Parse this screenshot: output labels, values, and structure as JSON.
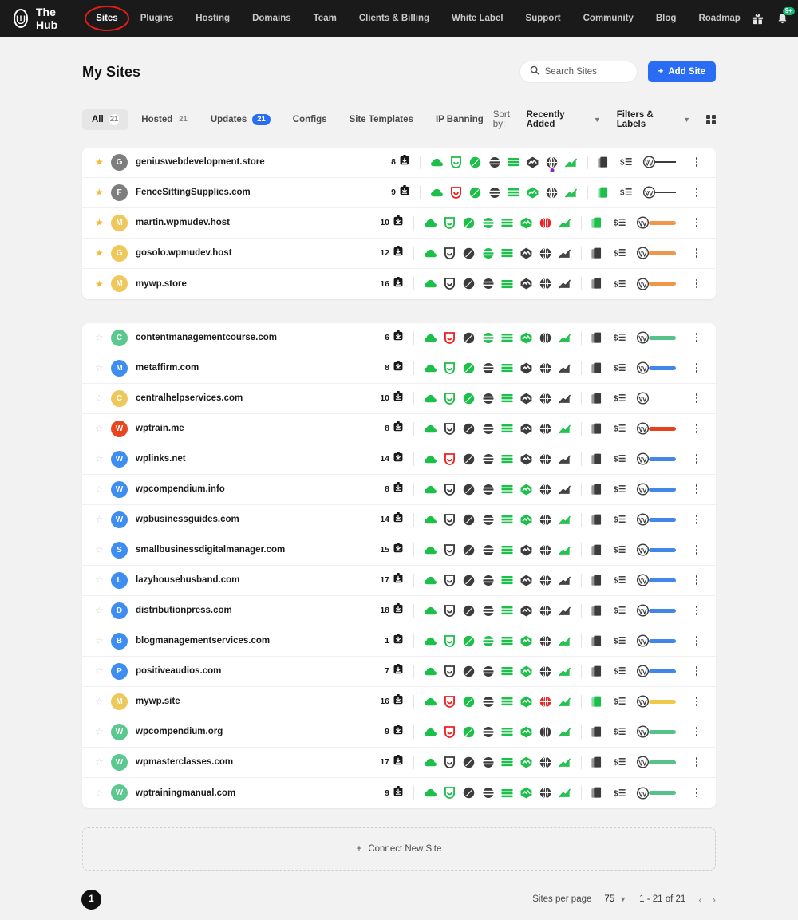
{
  "topnav": {
    "brand": "The Hub",
    "logo_icon": "hub-logo-icon",
    "items": [
      {
        "label": "Sites",
        "active": true,
        "circled": true
      },
      {
        "label": "Plugins",
        "active": false,
        "circled": false
      },
      {
        "label": "Hosting",
        "active": false,
        "circled": false
      },
      {
        "label": "Domains",
        "active": false,
        "circled": false
      },
      {
        "label": "Team",
        "active": false,
        "circled": false
      },
      {
        "label": "Clients & Billing",
        "active": false,
        "circled": false
      },
      {
        "label": "White Label",
        "active": false,
        "circled": false
      },
      {
        "label": "Support",
        "active": false,
        "circled": false
      },
      {
        "label": "Community",
        "active": false,
        "circled": false
      },
      {
        "label": "Blog",
        "active": false,
        "circled": false
      },
      {
        "label": "Roadmap",
        "active": false,
        "circled": false
      }
    ],
    "gift_icon": "gift-icon",
    "bell_icon": "bell-icon",
    "notification_badge": "9+",
    "gear_icon": "gear-icon",
    "avatar": "user-avatar"
  },
  "header": {
    "title": "My Sites",
    "search_placeholder": "Search Sites",
    "search_value": "",
    "search_icon": "search-icon",
    "add_site_label": "Add Site",
    "add_site_plus": "+",
    "accent_blue": "#2a6df4"
  },
  "tabbar": {
    "tabs": [
      {
        "label": "All",
        "count": "21",
        "active": true,
        "count_style": "plain"
      },
      {
        "label": "Hosted",
        "count": "21",
        "active": false,
        "count_style": "plain"
      },
      {
        "label": "Updates",
        "count": "21",
        "active": false,
        "count_style": "blue"
      },
      {
        "label": "Configs",
        "count": "",
        "active": false,
        "count_style": "none"
      },
      {
        "label": "Site Templates",
        "count": "",
        "active": false,
        "count_style": "none"
      },
      {
        "label": "IP Banning",
        "count": "",
        "active": false,
        "count_style": "none"
      }
    ],
    "sort_label": "Sort by:",
    "sort_value": "Recently Added",
    "filters_label": "Filters & Labels",
    "grid_toggle_icon": "grid-view-icon"
  },
  "service_icons": [
    "cloud-icon",
    "shield-icon",
    "smush-icon",
    "hummingbird-icon",
    "defender-icon",
    "branda-icon",
    "smartcrawl-icon",
    "analytics-icon"
  ],
  "tail_icons": [
    "pages-icon",
    "billing-icon",
    "wordpress-icon"
  ],
  "groups": [
    {
      "name": "favourites",
      "rows": [
        {
          "starred": true,
          "letter": "G",
          "avatar_color": "#7e7e7e",
          "name": "geniuswebdevelopment.store",
          "updates": "8",
          "svc": [
            "green",
            "green",
            "green",
            "dark",
            "green",
            "dark",
            "dark-purple",
            "green"
          ],
          "tail": [
            "dark",
            "dark",
            "dark"
          ],
          "status": "dash",
          "status_color": ""
        },
        {
          "starred": true,
          "letter": "F",
          "avatar_color": "#7e7e7e",
          "name": "FenceSittingSupplies.com",
          "updates": "9",
          "svc": [
            "green",
            "red",
            "green",
            "dark",
            "green",
            "green",
            "dark",
            "green"
          ],
          "tail": [
            "green",
            "dark",
            "dark"
          ],
          "status": "dash",
          "status_color": ""
        },
        {
          "starred": true,
          "letter": "M",
          "avatar_color": "#efc85c",
          "name": "martin.wpmudev.host",
          "updates": "10",
          "svc": [
            "green",
            "green",
            "green",
            "green",
            "green",
            "green",
            "red",
            "green"
          ],
          "tail": [
            "green",
            "dark",
            "dark"
          ],
          "status": "pill",
          "status_color": "#f0964b"
        },
        {
          "starred": true,
          "letter": "G",
          "avatar_color": "#efc85c",
          "name": "gosolo.wpmudev.host",
          "updates": "12",
          "svc": [
            "green",
            "dark",
            "dark",
            "green",
            "green",
            "dark",
            "dark",
            "dark"
          ],
          "tail": [
            "dark",
            "dark",
            "dark"
          ],
          "status": "pill",
          "status_color": "#f0964b"
        },
        {
          "starred": true,
          "letter": "M",
          "avatar_color": "#efc85c",
          "name": "mywp.store",
          "updates": "16",
          "svc": [
            "green",
            "dark",
            "dark",
            "dark",
            "green",
            "dark",
            "dark",
            "dark"
          ],
          "tail": [
            "dark",
            "dark",
            "dark"
          ],
          "status": "pill",
          "status_color": "#f0964b"
        }
      ]
    },
    {
      "name": "all-sites",
      "rows": [
        {
          "starred": false,
          "letter": "C",
          "avatar_color": "#5bc98f",
          "name": "contentmanagementcourse.com",
          "updates": "6",
          "svc": [
            "green",
            "red",
            "dark",
            "green",
            "green",
            "green",
            "dark",
            "green"
          ],
          "tail": [
            "dark",
            "dark",
            "dark"
          ],
          "status": "pill",
          "status_color": "#56c189"
        },
        {
          "starred": false,
          "letter": "M",
          "avatar_color": "#3d8ef0",
          "name": "metaffirm.com",
          "updates": "8",
          "svc": [
            "green",
            "green",
            "green",
            "dark",
            "green",
            "dark",
            "dark",
            "dark"
          ],
          "tail": [
            "dark",
            "dark",
            "dark"
          ],
          "status": "pill",
          "status_color": "#4287e8"
        },
        {
          "starred": false,
          "letter": "C",
          "avatar_color": "#efc85c",
          "name": "centralhelpservices.com",
          "updates": "10",
          "svc": [
            "green",
            "green",
            "green",
            "dark",
            "green",
            "dark",
            "dark",
            "dark"
          ],
          "tail": [
            "dark",
            "dark",
            "dark"
          ],
          "status": "pill",
          "status_color": "#f0c košice"
        },
        {
          "starred": false,
          "letter": "W",
          "avatar_color": "#e8461e",
          "name": "wptrain.me",
          "updates": "8",
          "svc": [
            "green",
            "dark",
            "dark",
            "dark",
            "green",
            "dark",
            "dark",
            "green"
          ],
          "tail": [
            "dark",
            "dark",
            "dark"
          ],
          "status": "pill",
          "status_color": "#e8401a"
        },
        {
          "starred": false,
          "letter": "W",
          "avatar_color": "#3d8ef0",
          "name": "wplinks.net",
          "updates": "14",
          "svc": [
            "green",
            "red",
            "dark",
            "dark",
            "green",
            "dark",
            "dark",
            "dark"
          ],
          "tail": [
            "dark",
            "dark",
            "dark"
          ],
          "status": "pill",
          "status_color": "#4287e8"
        },
        {
          "starred": false,
          "letter": "W",
          "avatar_color": "#3d8ef0",
          "name": "wpcompendium.info",
          "updates": "8",
          "svc": [
            "green",
            "dark",
            "dark",
            "dark",
            "green",
            "green",
            "dark",
            "dark"
          ],
          "tail": [
            "dark",
            "dark",
            "dark"
          ],
          "status": "pill",
          "status_color": "#4287e8"
        },
        {
          "starred": false,
          "letter": "W",
          "avatar_color": "#3d8ef0",
          "name": "wpbusinessguides.com",
          "updates": "14",
          "svc": [
            "green",
            "dark",
            "dark",
            "dark",
            "green",
            "green",
            "dark",
            "green"
          ],
          "tail": [
            "dark",
            "dark",
            "dark"
          ],
          "status": "pill",
          "status_color": "#4287e8"
        },
        {
          "starred": false,
          "letter": "S",
          "avatar_color": "#3d8ef0",
          "name": "smallbusinessdigitalmanager.com",
          "updates": "15",
          "svc": [
            "green",
            "dark",
            "dark",
            "dark",
            "green",
            "dark",
            "dark",
            "green"
          ],
          "tail": [
            "dark",
            "dark",
            "dark"
          ],
          "status": "pill",
          "status_color": "#4287e8"
        },
        {
          "starred": false,
          "letter": "L",
          "avatar_color": "#3d8ef0",
          "name": "lazyhousehusband.com",
          "updates": "17",
          "svc": [
            "green",
            "dark",
            "dark",
            "dark",
            "green",
            "dark",
            "dark",
            "dark"
          ],
          "tail": [
            "dark",
            "dark",
            "dark"
          ],
          "status": "pill",
          "status_color": "#4287e8"
        },
        {
          "starred": false,
          "letter": "D",
          "avatar_color": "#3d8ef0",
          "name": "distributionpress.com",
          "updates": "18",
          "svc": [
            "green",
            "dark",
            "dark",
            "dark",
            "green",
            "dark",
            "dark",
            "dark"
          ],
          "tail": [
            "dark",
            "dark",
            "dark"
          ],
          "status": "pill",
          "status_color": "#4287e8"
        },
        {
          "starred": false,
          "letter": "B",
          "avatar_color": "#3d8ef0",
          "name": "blogmanagementservices.com",
          "updates": "1",
          "svc": [
            "green",
            "green",
            "green",
            "green",
            "green",
            "green",
            "dark",
            "green"
          ],
          "tail": [
            "dark",
            "dark",
            "dark"
          ],
          "status": "pill",
          "status_color": "#4287e8"
        },
        {
          "starred": false,
          "letter": "P",
          "avatar_color": "#3d8ef0",
          "name": "positiveaudios.com",
          "updates": "7",
          "svc": [
            "green",
            "dark",
            "dark",
            "dark",
            "green",
            "green",
            "dark",
            "green"
          ],
          "tail": [
            "dark",
            "dark",
            "dark"
          ],
          "status": "pill",
          "status_color": "#4287e8"
        },
        {
          "starred": false,
          "letter": "M",
          "avatar_color": "#efc85c",
          "name": "mywp.site",
          "updates": "16",
          "svc": [
            "green",
            "red",
            "green",
            "dark",
            "green",
            "green",
            "red",
            "green"
          ],
          "tail": [
            "green",
            "dark",
            "dark"
          ],
          "status": "pill",
          "status_color": "#f0c94b"
        },
        {
          "starred": false,
          "letter": "W",
          "avatar_color": "#5bc98f",
          "name": "wpcompendium.org",
          "updates": "9",
          "svc": [
            "green",
            "red",
            "green",
            "dark",
            "green",
            "green",
            "dark",
            "green"
          ],
          "tail": [
            "dark",
            "dark",
            "dark"
          ],
          "status": "pill",
          "status_color": "#56c189"
        },
        {
          "starred": false,
          "letter": "W",
          "avatar_color": "#5bc98f",
          "name": "wpmasterclasses.com",
          "updates": "17",
          "svc": [
            "green",
            "dark",
            "dark",
            "dark",
            "green",
            "green",
            "dark",
            "green"
          ],
          "tail": [
            "dark",
            "dark",
            "dark"
          ],
          "status": "pill",
          "status_color": "#56c189"
        },
        {
          "starred": false,
          "letter": "W",
          "avatar_color": "#5bc98f",
          "name": "wptrainingmanual.com",
          "updates": "9",
          "svc": [
            "green",
            "green",
            "dark",
            "dark",
            "green",
            "green",
            "dark",
            "green"
          ],
          "tail": [
            "dark",
            "dark",
            "dark"
          ],
          "status": "pill",
          "status_color": "#56c189"
        }
      ]
    }
  ],
  "footer": {
    "connect_label": "Connect New Site",
    "connect_plus": "+",
    "marker": "1",
    "per_page_label": "Sites per page",
    "per_page_value": "75",
    "range": "1 - 21 of 21",
    "prev_icon": "chevron-left-icon",
    "next_icon": "chevron-right-icon"
  }
}
